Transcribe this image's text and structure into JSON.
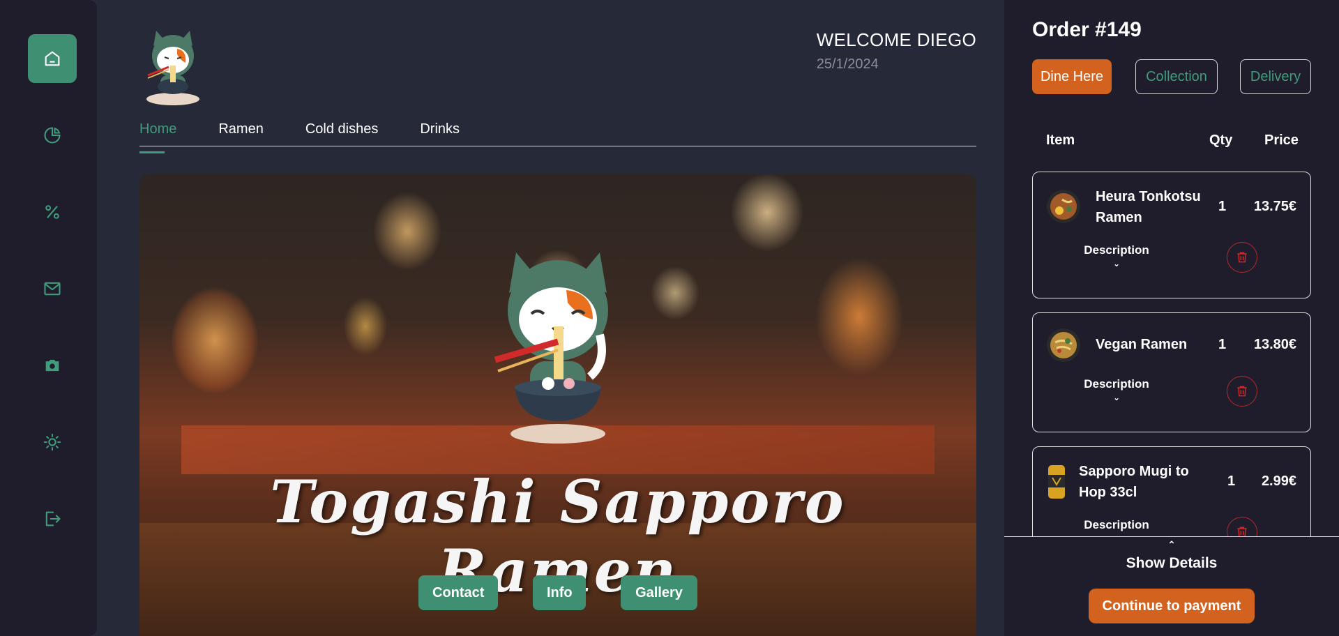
{
  "sidebar": {
    "items": [
      {
        "icon": "home-icon",
        "active": true
      },
      {
        "icon": "pie-chart-icon",
        "active": false
      },
      {
        "icon": "percent-icon",
        "active": false
      },
      {
        "icon": "mail-icon",
        "active": false
      },
      {
        "icon": "camera-icon",
        "active": false
      },
      {
        "icon": "sun-icon",
        "active": false
      },
      {
        "icon": "logout-icon",
        "active": false
      }
    ]
  },
  "header": {
    "welcome": "WELCOME DIEGO",
    "date": "25/1/2024"
  },
  "tabs": [
    {
      "label": "Home",
      "active": true
    },
    {
      "label": "Ramen",
      "active": false
    },
    {
      "label": "Cold dishes",
      "active": false
    },
    {
      "label": "Drinks",
      "active": false
    }
  ],
  "hero": {
    "title": "Togashi Sapporo Ramen",
    "buttons": {
      "contact": "Contact",
      "info": "Info",
      "gallery": "Gallery"
    }
  },
  "order": {
    "title": "Order #149",
    "types": {
      "dine_here": "Dine Here",
      "collection": "Collection",
      "delivery": "Delivery"
    },
    "columns": {
      "item": "Item",
      "qty": "Qty",
      "price": "Price"
    },
    "items": [
      {
        "name": "Heura Tonkotsu Ramen",
        "qty": "1",
        "price": "13.75€",
        "description_label": "Description"
      },
      {
        "name": "Vegan Ramen",
        "qty": "1",
        "price": "13.80€",
        "description_label": "Description"
      },
      {
        "name": "Sapporo Mugi to Hop 33cl",
        "qty": "1",
        "price": "2.99€",
        "description_label": "Description"
      }
    ],
    "show_details": "Show Details",
    "pay": "Continue to payment"
  },
  "colors": {
    "accent_green": "#3f8f73",
    "accent_orange": "#d3621f",
    "panel_bg": "#1f1d2b",
    "main_bg": "#262938",
    "danger": "#b32b2b"
  }
}
